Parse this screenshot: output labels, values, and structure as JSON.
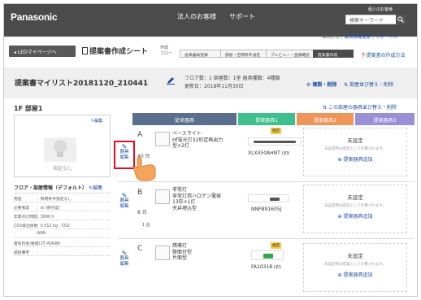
{
  "header": {
    "logo": "Panasonic",
    "nav_customer": "法人のお客様",
    "nav_support": "サポート",
    "account": "個人のお客様",
    "search_placeholder": "検索キーワード"
  },
  "userline": {
    "user": "津田さん",
    "profile_link": "会員情報変更",
    "help_link": "サポートの",
    "sep1": " | ",
    "sep2": " | "
  },
  "toolbar": {
    "mypage_button": "LEDマイページへ",
    "page_title": "提案書作成シート",
    "flow_label": "作成\nフロー",
    "flow_steps": [
      "従来器具登録",
      "部屋・空間条件設定",
      "プレビュー・金額確認",
      "提案書作成"
    ],
    "flow_help": "提案書の作成方法"
  },
  "list": {
    "name": "提案書マイリスト20181120_210441",
    "floor_info": "フロア数：1 部屋数：1室 器具種類：4種類",
    "updated": "更新日：2018年11月30日",
    "link_copy_delete": "複製・削除",
    "link_reorder": "部屋並び替え・削除"
  },
  "room": {
    "title": "1F  部屋1",
    "reorder_link": "この部屋の器具並び替え・削除",
    "edit_label": "編集",
    "no_spec": "指定なし",
    "col_existing": "従来器具",
    "col_prop1": "提案器具1",
    "col_prop2": "提案器具2",
    "col_prop3": "提案器具3",
    "info_title": "フロア・部屋情報（デフォルト）",
    "info_edit": "編集",
    "info_rows": [
      {
        "k": "用途",
        "v": "：照明条件指定なし"
      },
      {
        "k": "必要照度",
        "v": "：lx (保守度)"
      },
      {
        "k": "年間点灯時間",
        "v": "：3000 h"
      },
      {
        "k": "CO2排出係数",
        "v": "：0.512 kg - CO2"
      },
      {
        "k": "",
        "v": "  /kWh"
      },
      {
        "k": "電気料金(税抜)",
        "v": "：25 円/kWh"
      },
      {
        "k": "部屋備考",
        "v": "："
      }
    ]
  },
  "rows": [
    {
      "letter": "A",
      "qty": "40 台",
      "tools_label_1": "器具",
      "tools_label_2": "編集",
      "desc": [
        "ベースライト",
        "Hf蛍光灯32形定格出力",
        "型×2灯"
      ],
      "model": "XLX450AHNT",
      "model_suffix": "LE9",
      "badge": "推奨",
      "unset": "未設定",
      "unset_note": "未設定時は提案として計算されます。",
      "add": "提案器具追加"
    },
    {
      "letter": "B",
      "qty": "8 台",
      "sub": "1 台",
      "tools_label_1": "器具",
      "tools_label_2": "編集",
      "desc": [
        "非常灯",
        "非常灯用ハロゲン電球",
        "13形×1灯",
        "天井埋込型"
      ],
      "model": "NNFB91605J",
      "unset": "未設定",
      "unset_note": "未設定時は提案として計算されます。",
      "add": "提案器具追加"
    },
    {
      "letter": "C",
      "qty": "",
      "tools_label_1": "器具",
      "tools_label_2": "編集",
      "desc": [
        "誘導灯",
        "壁面付型",
        "片面型"
      ],
      "model": "FA10318",
      "model_suffix": "LE1",
      "badge": "推奨",
      "unset": "未設定",
      "unset_note": "未設定時は提案として計算されます。",
      "add": "提案器具追加"
    }
  ],
  "colors": {
    "header": "#4b4b4b",
    "existing": "#5a6f8e",
    "prop1": "#3fbf8f",
    "prop2": "#f0955a",
    "prop3": "#9b8fd6",
    "link": "#1a4fa0",
    "highlight": "#e01020"
  }
}
